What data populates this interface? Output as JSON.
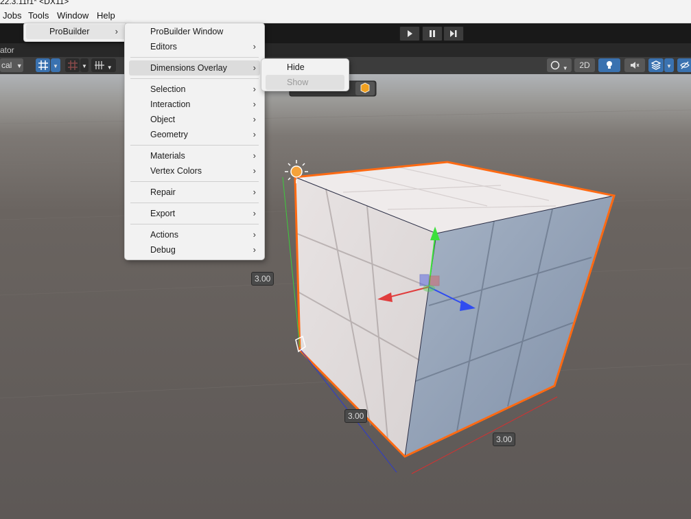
{
  "window": {
    "title": "22.3.11f1* <DX11>"
  },
  "menubar": {
    "items": [
      "Jobs",
      "Tools",
      "Window",
      "Help"
    ]
  },
  "tools_menu": {
    "items": [
      {
        "label": "ProBuilder",
        "arrow": "›"
      }
    ]
  },
  "probuilder_menu": {
    "groups": [
      [
        {
          "label": "ProBuilder Window"
        },
        {
          "label": "Editors",
          "arrow": "›"
        }
      ],
      [
        {
          "label": "Dimensions Overlay",
          "arrow": "›"
        }
      ],
      [
        {
          "label": "Selection",
          "arrow": "›"
        },
        {
          "label": "Interaction",
          "arrow": "›"
        },
        {
          "label": "Object",
          "arrow": "›"
        },
        {
          "label": "Geometry",
          "arrow": "›"
        }
      ],
      [
        {
          "label": "Materials",
          "arrow": "›"
        },
        {
          "label": "Vertex Colors",
          "arrow": "›"
        }
      ],
      [
        {
          "label": "Repair",
          "arrow": "›"
        }
      ],
      [
        {
          "label": "Export",
          "arrow": "›"
        }
      ],
      [
        {
          "label": "Actions",
          "arrow": "›"
        },
        {
          "label": "Debug",
          "arrow": "›"
        }
      ]
    ]
  },
  "dimensions_submenu": {
    "hide_label": "Hide",
    "show_label": "Show"
  },
  "scene_tab": {
    "label": "ator"
  },
  "scene_toolbar": {
    "pivot_label": "cal",
    "view_2d_label": "2D"
  },
  "dimensions": {
    "height": "3.00",
    "depth": "3.00",
    "width": "3.00"
  },
  "colors": {
    "selection_outline": "#ff6a13",
    "menu_bg": "#f2f2f2",
    "toolbar_bg": "#191919"
  },
  "icons": [
    "play-icon",
    "pause-icon",
    "step-icon",
    "light-icon",
    "cube-icon"
  ]
}
